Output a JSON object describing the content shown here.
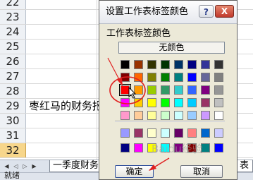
{
  "spreadsheet": {
    "rows": [
      {
        "number": "22",
        "text": "",
        "selected": false
      },
      {
        "number": "23",
        "text": "",
        "selected": false
      },
      {
        "number": "24",
        "text": "",
        "selected": false
      },
      {
        "number": "25",
        "text": "",
        "selected": false
      },
      {
        "number": "26",
        "text": "",
        "selected": false
      },
      {
        "number": "27",
        "text": "",
        "selected": false
      },
      {
        "number": "28",
        "text": "",
        "selected": false
      },
      {
        "number": "29",
        "text": "枣红马的财务报",
        "selected": false
      },
      {
        "number": "30",
        "text": "",
        "selected": false
      },
      {
        "number": "31",
        "text": "",
        "selected": false
      },
      {
        "number": "32",
        "text": "",
        "selected": true
      }
    ],
    "sheet_tabs": [
      "一季度财务",
      "表"
    ],
    "status": "就绪"
  },
  "dialog": {
    "title": "设置工作表标签颜色",
    "help_label": "?",
    "close_label": "X",
    "section_label": "工作表标签颜色",
    "no_color_label": "无颜色",
    "ok_label": "确定",
    "cancel_label": "取消",
    "selected_color": "#ff0000",
    "palette_top": [
      [
        "#000000",
        "#993300",
        "#333300",
        "#003300",
        "#003366",
        "#000080",
        "#333399",
        "#333333"
      ],
      [
        "#800000",
        "#ff6600",
        "#808000",
        "#008000",
        "#008080",
        "#0000ff",
        "#666699",
        "#808080"
      ],
      [
        "#ff0000",
        "#ff9900",
        "#99cc00",
        "#339966",
        "#33cccc",
        "#3366ff",
        "#800080",
        "#969696"
      ],
      [
        "#ff00ff",
        "#ffcc00",
        "#ffff00",
        "#00ff00",
        "#00ffff",
        "#00ccff",
        "#993366",
        "#c0c0c0"
      ],
      [
        "#ff99cc",
        "#ffcc99",
        "#ffff99",
        "#ccffcc",
        "#ccffff",
        "#99ccff",
        "#cc99ff",
        "#ffffff"
      ]
    ],
    "palette_bottom": [
      [
        "#9999ff",
        "#993366",
        "#ffffcc",
        "#ccffff",
        "#660066",
        "#ff8080",
        "#0066cc",
        "#ccccff"
      ],
      [
        "#000080",
        "#ff00ff",
        "#ffff00",
        "#00ffff",
        "#800080",
        "#800000",
        "#008080",
        "#0000ff"
      ]
    ]
  },
  "annotation": {
    "color": "#e02020",
    "watermark": "Baidu经验"
  }
}
